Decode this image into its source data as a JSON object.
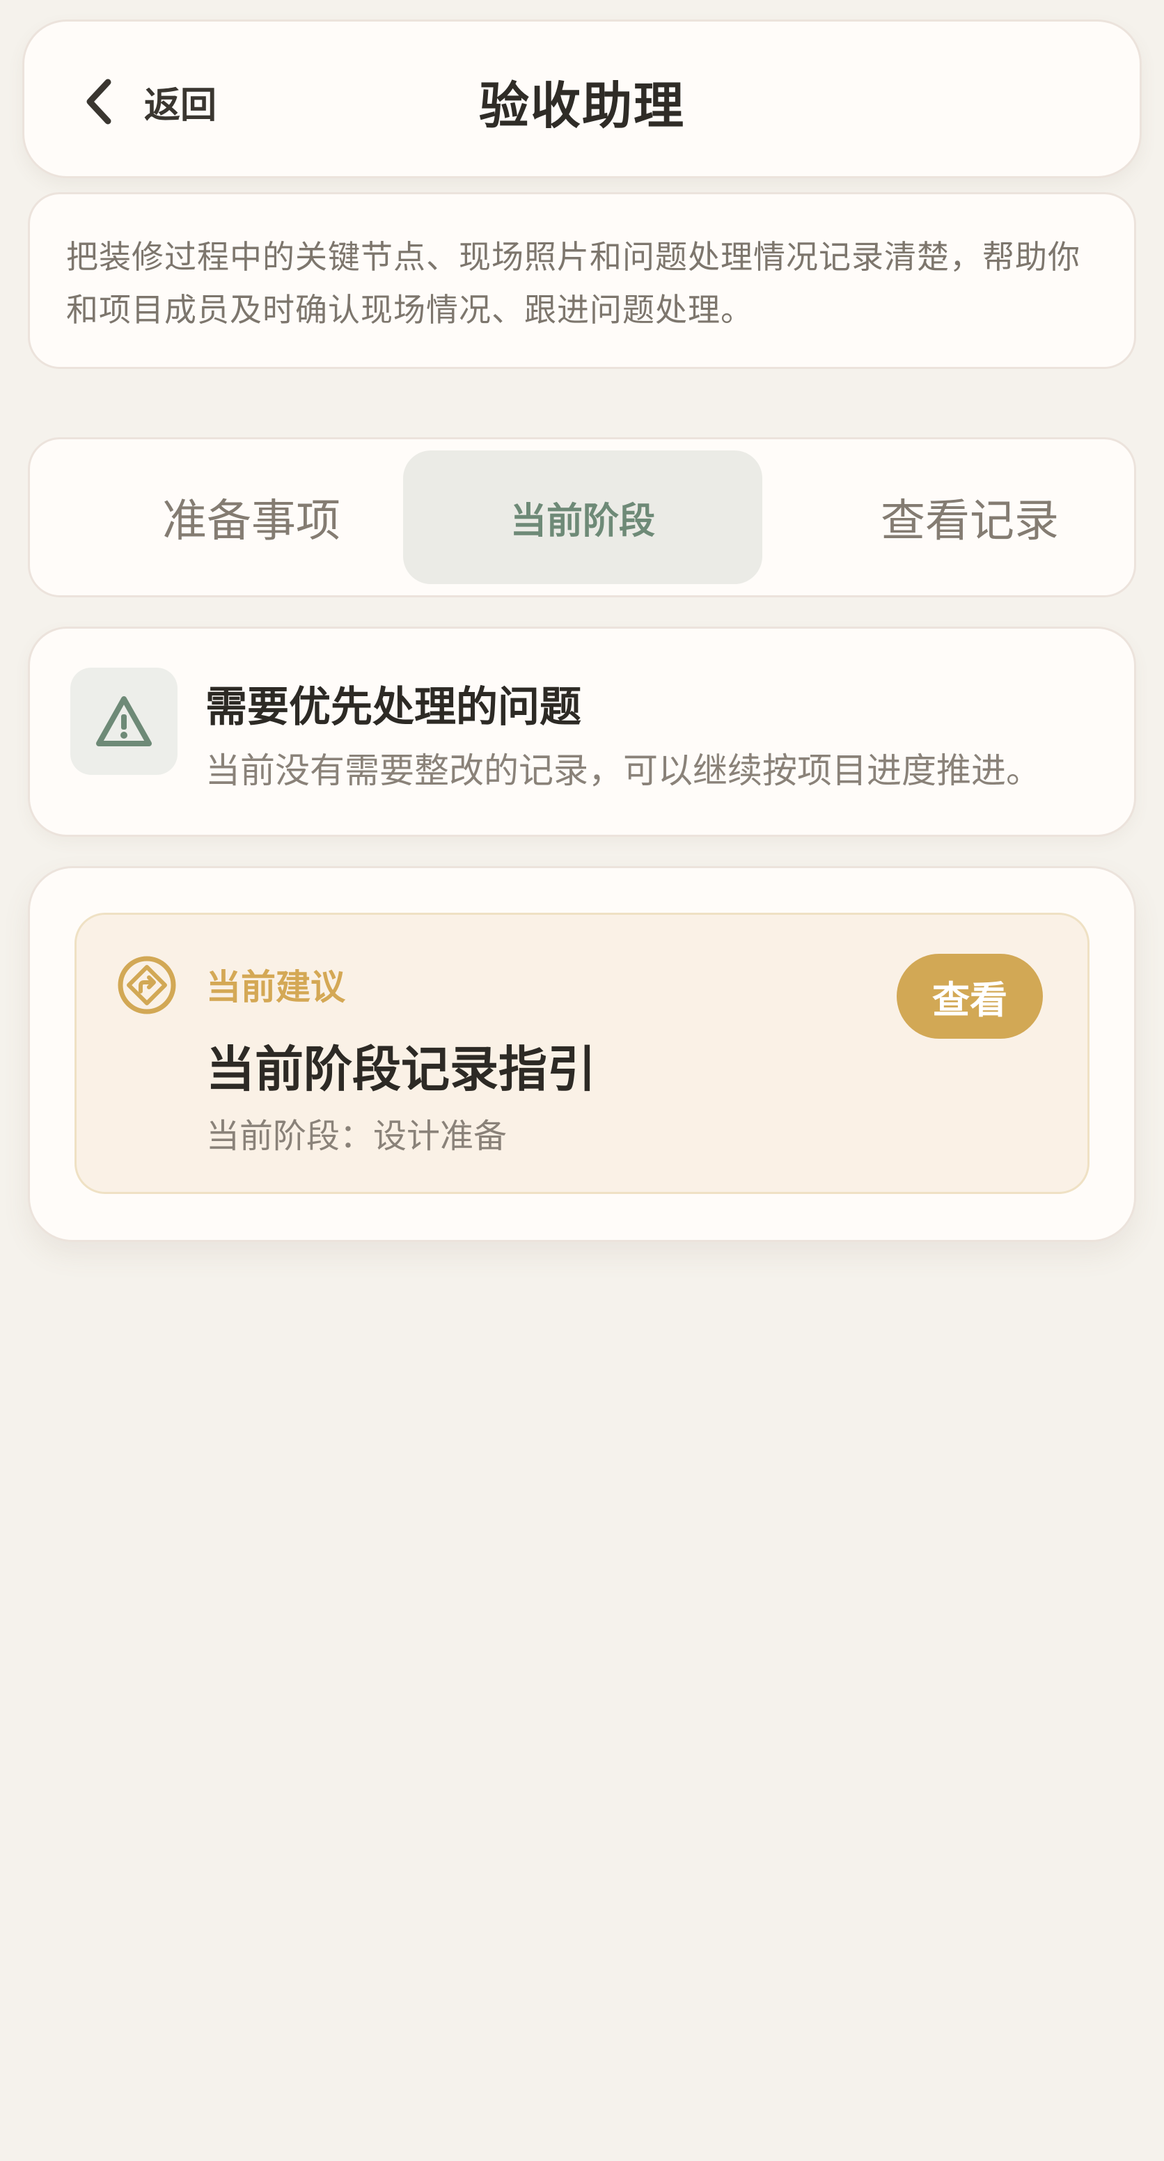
{
  "header": {
    "back_label": "返回",
    "title": "验收助理"
  },
  "intro": {
    "text": "把装修过程中的关键节点、现场照片和问题处理情况记录清楚，帮助你和项目成员及时确认现场情况、跟进问题处理。"
  },
  "tabs": [
    {
      "label": "准备事项",
      "active": false
    },
    {
      "label": "当前阶段",
      "active": true
    },
    {
      "label": "查看记录",
      "active": false
    }
  ],
  "issues": {
    "icon": "warning-triangle-icon",
    "title": "需要优先处理的问题",
    "description": "当前没有需要整改的记录，可以继续按项目进度推进。"
  },
  "suggestion": {
    "icon": "direction-sign-icon",
    "label": "当前建议",
    "title": "当前阶段记录指引",
    "stage": "当前阶段：设计准备",
    "button_label": "查看"
  },
  "colors": {
    "background": "#f5f2ec",
    "card": "#fffcf9",
    "accent_gold": "#d2a855",
    "accent_green": "#6e8a77",
    "text_dark": "#2d2a25",
    "text_muted": "#8a8279"
  }
}
